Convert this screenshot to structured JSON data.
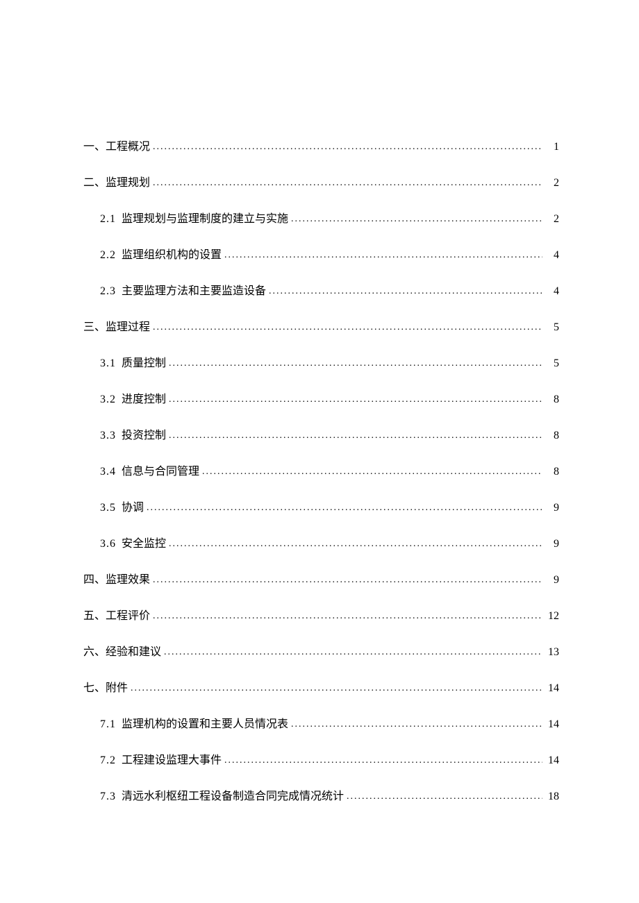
{
  "toc": [
    {
      "level": 1,
      "number": "",
      "label": "一、工程概况",
      "page": "1"
    },
    {
      "level": 1,
      "number": "",
      "label": "二、监理规划",
      "page": "2"
    },
    {
      "level": 2,
      "number": "2.1",
      "label": "监理规划与监理制度的建立与实施",
      "page": "2"
    },
    {
      "level": 2,
      "number": "2.2",
      "label": "监理组织机构的设置",
      "page": "4"
    },
    {
      "level": 2,
      "number": "2.3",
      "label": "主要监理方法和主要监造设备",
      "page": "4"
    },
    {
      "level": 1,
      "number": "",
      "label": "三、监理过程",
      "page": "5"
    },
    {
      "level": 2,
      "number": "3.1",
      "label": "质量控制",
      "page": "5"
    },
    {
      "level": 2,
      "number": "3.2",
      "label": "进度控制",
      "page": "8"
    },
    {
      "level": 2,
      "number": "3.3",
      "label": "投资控制",
      "page": "8"
    },
    {
      "level": 2,
      "number": "3.4",
      "label": "信息与合同管理",
      "page": "8"
    },
    {
      "level": 2,
      "number": "3.5",
      "label": "协调",
      "page": "9"
    },
    {
      "level": 2,
      "number": "3.6",
      "label": "安全监控",
      "page": "9"
    },
    {
      "level": 1,
      "number": "",
      "label": "四、监理效果",
      "page": "9"
    },
    {
      "level": 1,
      "number": "",
      "label": "五、工程评价",
      "page": "12"
    },
    {
      "level": 1,
      "number": "",
      "label": "六、经验和建议",
      "page": "13"
    },
    {
      "level": 1,
      "number": "",
      "label": "七、附件",
      "page": "14"
    },
    {
      "level": 2,
      "number": "7.1",
      "label": "监理机构的设置和主要人员情况表",
      "page": "14"
    },
    {
      "level": 2,
      "number": "7.2",
      "label": "工程建设监理大事件",
      "page": "14"
    },
    {
      "level": 2,
      "number": "7.3",
      "label": "清远水利枢纽工程设备制造合同完成情况统计",
      "page": "18"
    }
  ]
}
